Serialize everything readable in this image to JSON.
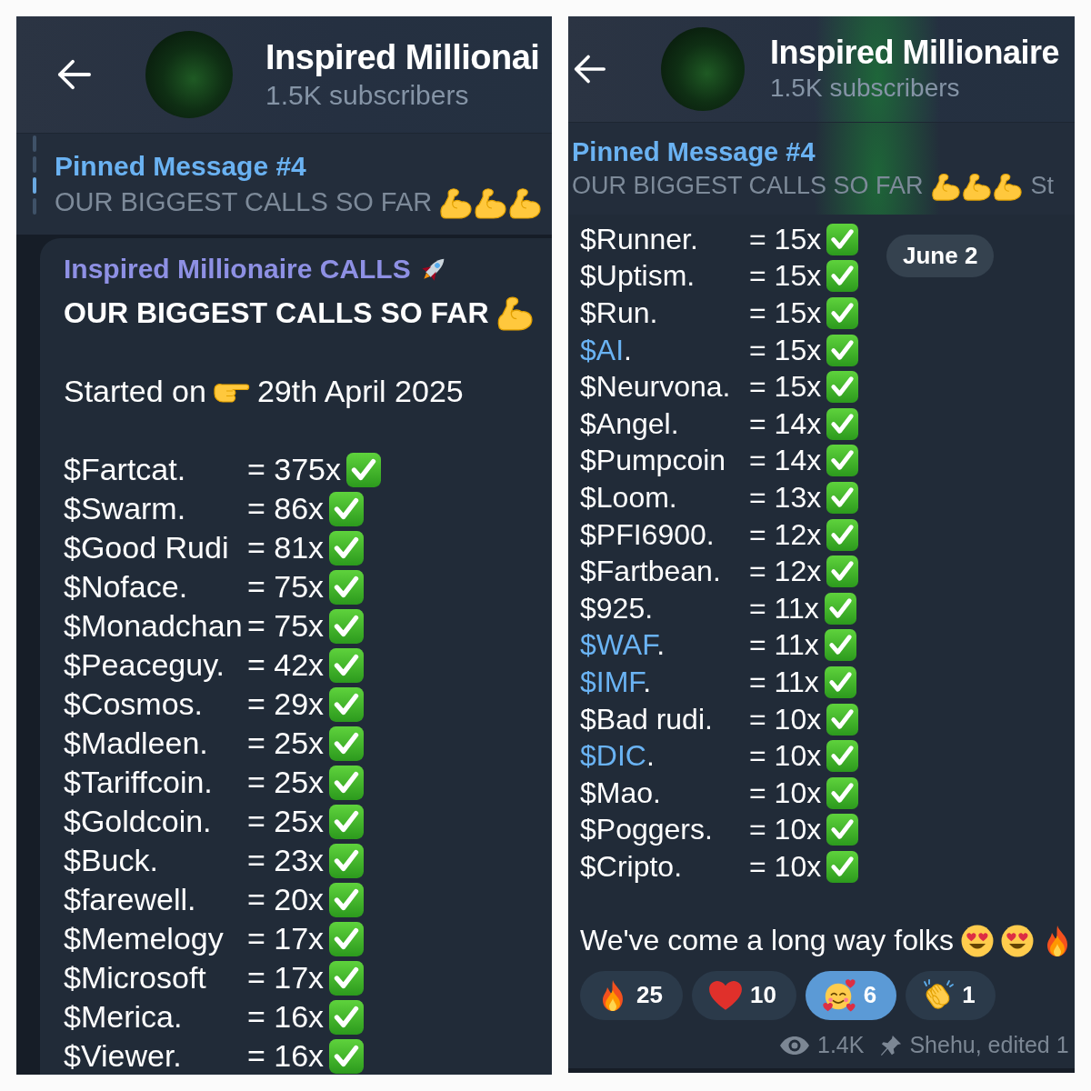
{
  "panels": [
    {
      "header": {
        "title": "Inspired Millionai",
        "subtitle": "1.5K subscribers"
      },
      "pinned": {
        "label": "Pinned Message #4",
        "preview": "OUR BIGGEST CALLS SO FAR",
        "indicator": [
          {
            "selected": false
          },
          {
            "selected": false
          },
          {
            "selected": true
          },
          {
            "selected": false
          }
        ]
      },
      "message": {
        "sender": "Inspired Millionaire CALLS",
        "headline": "OUR BIGGEST CALLS SO FAR",
        "started": {
          "label": "Started on",
          "date": "29th April 2025"
        },
        "calls": [
          {
            "name": "$Fartcat.",
            "value": "= 375x",
            "link": false
          },
          {
            "name": "$Swarm.",
            "value": "= 86x",
            "link": false
          },
          {
            "name": "$Good Rudi",
            "value": "= 81x",
            "link": false
          },
          {
            "name": "$Noface.",
            "value": "= 75x",
            "link": false
          },
          {
            "name": "$Monadchan",
            "value": "= 75x",
            "link": false
          },
          {
            "name": "$Peaceguy.",
            "value": "= 42x",
            "link": false
          },
          {
            "name": "$Cosmos.",
            "value": "= 29x",
            "link": false
          },
          {
            "name": "$Madleen.",
            "value": "= 25x",
            "link": false
          },
          {
            "name": "$Tariffcoin.",
            "value": "= 25x",
            "link": false
          },
          {
            "name": "$Goldcoin.",
            "value": "= 25x",
            "link": false
          },
          {
            "name": "$Buck.",
            "value": "= 23x",
            "link": false
          },
          {
            "name": "$farewell.",
            "value": "= 20x",
            "link": false
          },
          {
            "name": "$Memelogy",
            "value": "= 17x",
            "link": false
          },
          {
            "name": "$Microsoft",
            "value": "= 17x",
            "link": false
          },
          {
            "name": "$Merica.",
            "value": "= 16x",
            "link": false
          },
          {
            "name": "$Viewer.",
            "value": "= 16x",
            "link": false
          }
        ]
      }
    },
    {
      "header": {
        "title": "Inspired Millionaire",
        "subtitle": "1.5K subscribers"
      },
      "pinned": {
        "label": "Pinned Message #4",
        "preview": "OUR BIGGEST CALLS SO FAR",
        "trailing": "St"
      },
      "date_badge": "June 2",
      "message": {
        "calls": [
          {
            "name": "$Runner.",
            "value": "= 15x",
            "link": false
          },
          {
            "name": "$Uptism.",
            "value": "= 15x",
            "link": false
          },
          {
            "name": "$Run.",
            "value": "= 15x",
            "link": false
          },
          {
            "name": "$AI",
            "suffix": ".",
            "value": "= 15x",
            "link": true
          },
          {
            "name": "$Neurvona.",
            "value": "= 15x",
            "link": false
          },
          {
            "name": "$Angel.",
            "value": "= 14x",
            "link": false
          },
          {
            "name": "$Pumpcoin",
            "value": "= 14x",
            "link": false
          },
          {
            "name": "$Loom.",
            "value": "= 13x",
            "link": false
          },
          {
            "name": "$PFI6900.",
            "value": "= 12x",
            "link": false
          },
          {
            "name": "$Fartbean.",
            "value": "= 12x",
            "link": false
          },
          {
            "name": "$925.",
            "value": "= 11x",
            "link": false
          },
          {
            "name": "$WAF",
            "suffix": ".",
            "value": "= 11x",
            "link": true
          },
          {
            "name": "$IMF",
            "suffix": ".",
            "value": "= 11x",
            "link": true
          },
          {
            "name": "$Bad rudi.",
            "value": "= 10x",
            "link": false
          },
          {
            "name": "$DIC",
            "suffix": ".",
            "value": "= 10x",
            "link": true
          },
          {
            "name": "$Mao.",
            "value": "= 10x",
            "link": false
          },
          {
            "name": "$Poggers.",
            "value": "= 10x",
            "link": false
          },
          {
            "name": "$Cripto.",
            "value": "= 10x",
            "link": false
          }
        ],
        "closing": "We've come a long way folks",
        "reactions": [
          {
            "kind": "fire",
            "count": "25",
            "selected": false
          },
          {
            "kind": "heart",
            "count": "10",
            "selected": false
          },
          {
            "kind": "smiling-hearts",
            "count": "6",
            "selected": true
          },
          {
            "kind": "clap",
            "count": "1",
            "selected": false
          }
        ],
        "views": "1.4K",
        "signature": "Shehu, edited 1"
      }
    }
  ]
}
